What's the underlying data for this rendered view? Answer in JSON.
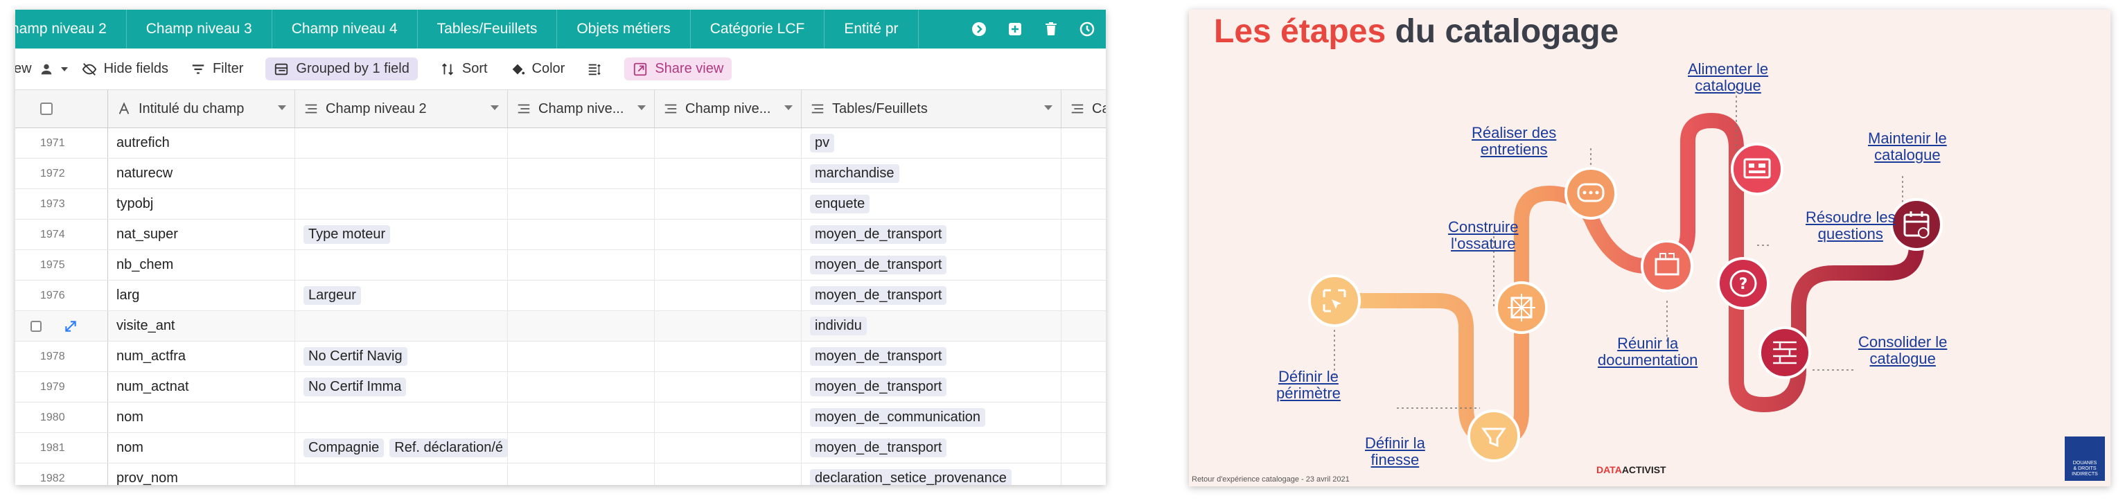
{
  "tabs": [
    "hamp niveau 2",
    "Champ niveau 3",
    "Champ niveau 4",
    "Tables/Feuillets",
    "Objets métiers",
    "Catégorie LCF",
    "Entité pr"
  ],
  "toolbar": {
    "view_label": "ew",
    "hide_fields": "Hide fields",
    "filter": "Filter",
    "grouped": "Grouped by 1 field",
    "sort": "Sort",
    "color": "Color",
    "share_view": "Share view"
  },
  "columns": [
    "Intitulé du champ",
    "Champ niveau 2",
    "Champ nive...",
    "Champ nive...",
    "Tables/Feuillets",
    "Cat"
  ],
  "rows": [
    {
      "num": "1971",
      "name": "autrefich",
      "lvl2": [],
      "table": "pv"
    },
    {
      "num": "1972",
      "name": "naturecw",
      "lvl2": [],
      "table": "marchandise"
    },
    {
      "num": "1973",
      "name": "typobj",
      "lvl2": [],
      "table": "enquete"
    },
    {
      "num": "1974",
      "name": "nat_super",
      "lvl2": [
        "Type moteur"
      ],
      "table": "moyen_de_transport"
    },
    {
      "num": "1975",
      "name": "nb_chem",
      "lvl2": [],
      "table": "moyen_de_transport"
    },
    {
      "num": "1976",
      "name": "larg",
      "lvl2": [
        "Largeur"
      ],
      "table": "moyen_de_transport"
    },
    {
      "num": "",
      "name": "visite_ant",
      "lvl2": [],
      "table": "individu",
      "highlight": true
    },
    {
      "num": "1978",
      "name": "num_actfra",
      "lvl2": [
        "No Certif Navig"
      ],
      "table": "moyen_de_transport"
    },
    {
      "num": "1979",
      "name": "num_actnat",
      "lvl2": [
        "No Certif Imma"
      ],
      "table": "moyen_de_transport"
    },
    {
      "num": "1980",
      "name": "nom",
      "lvl2": [],
      "table": "moyen_de_communication"
    },
    {
      "num": "1981",
      "name": "nom",
      "lvl2": [
        "Compagnie",
        "Ref. déclaration/é"
      ],
      "table": "moyen_de_transport"
    },
    {
      "num": "1982",
      "name": "prov_nom",
      "lvl2": [],
      "table": "declaration_setice_provenance"
    }
  ],
  "slide": {
    "title_red": "Les étapes",
    "title_dark": " du catalogage",
    "steps": {
      "definir_perimetre": "Définir le\npérimètre",
      "definir_finesse": "Définir la\nfinesse",
      "construire": "Construire\nl'ossature",
      "realiser": "Réaliser des\nentretiens",
      "reunir": "Réunir la\ndocumentation",
      "alimenter": "Alimenter le\ncatalogue",
      "resoudre": "Résoudre les\nquestions",
      "consolider": "Consolider le\ncatalogue",
      "maintenir": "Maintenir le\ncatalogue"
    },
    "footer": "Retour d'expérience catalogage - 23 avril 2021",
    "brand_red": "DATA",
    "brand_dark": "ACTIVIST",
    "logo_text": "DOUANES\n& DROITS\nINDIRECTS"
  },
  "colors": {
    "teal": "#12a8a1",
    "road_light": "#f7b26a",
    "road_mid": "#ee6f5e",
    "road_dark": "#b0283d",
    "title_red": "#e8473f"
  }
}
